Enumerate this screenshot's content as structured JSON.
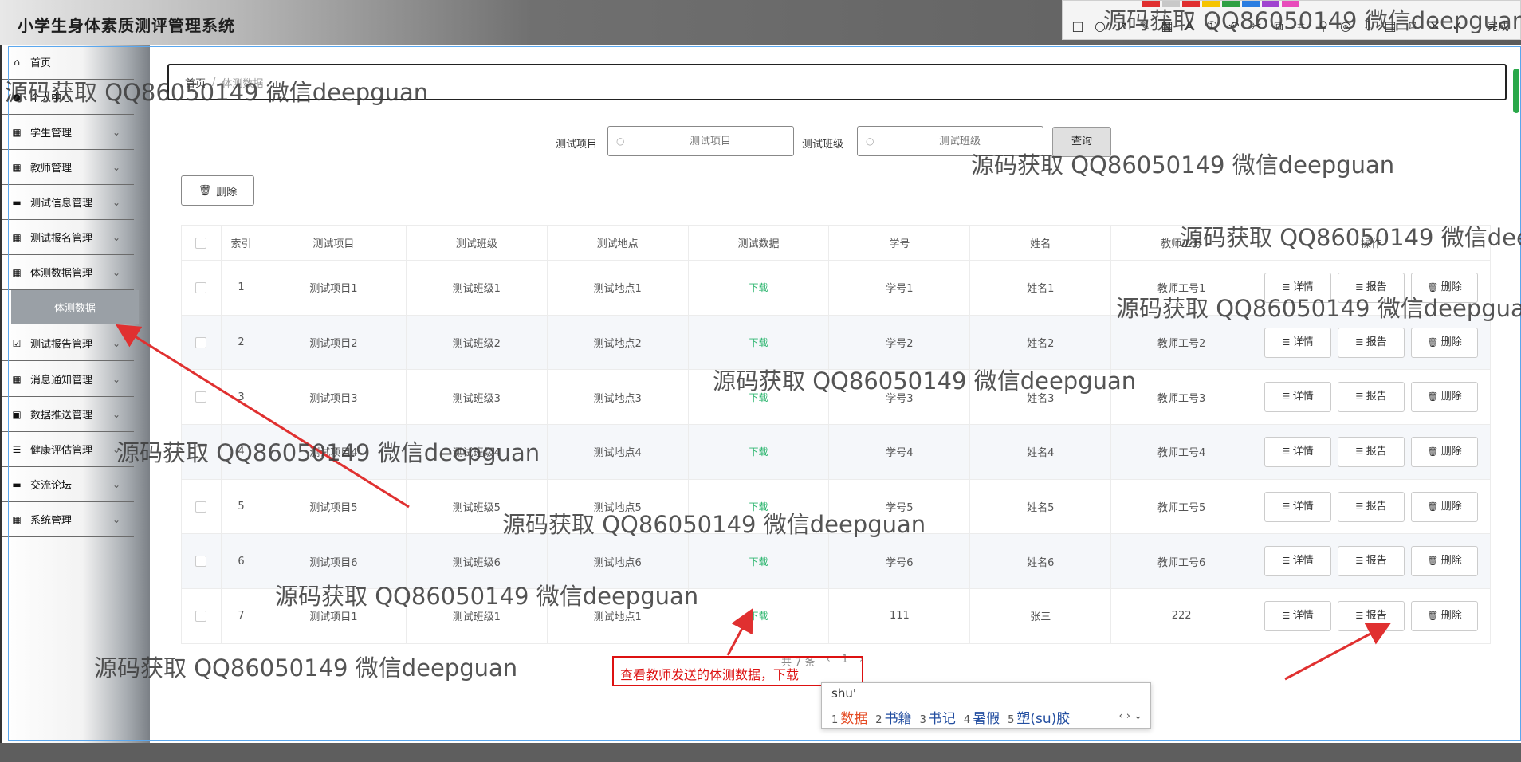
{
  "app": {
    "title": "小学生身体素质测评管理系统"
  },
  "sidebar": {
    "items": [
      {
        "label": "首页",
        "icon": "home-icon",
        "has_children": false
      },
      {
        "label": "个人中心",
        "icon": "user-icon",
        "has_children": false
      },
      {
        "label": "学生管理",
        "icon": "grid-icon",
        "has_children": true
      },
      {
        "label": "教师管理",
        "icon": "grid-icon",
        "has_children": true
      },
      {
        "label": "测试信息管理",
        "icon": "card-icon",
        "has_children": true
      },
      {
        "label": "测试报名管理",
        "icon": "grid-icon",
        "has_children": true
      },
      {
        "label": "体测数据管理",
        "icon": "grid-icon",
        "has_children": true
      },
      {
        "label": "测试报告管理",
        "icon": "check-icon",
        "has_children": true
      },
      {
        "label": "消息通知管理",
        "icon": "grid-icon",
        "has_children": true
      },
      {
        "label": "数据推送管理",
        "icon": "chart-icon",
        "has_children": true
      },
      {
        "label": "健康评估管理",
        "icon": "sliders-icon",
        "has_children": true
      },
      {
        "label": "交流论坛",
        "icon": "chat-icon",
        "has_children": true
      },
      {
        "label": "系统管理",
        "icon": "grid-icon",
        "has_children": true
      }
    ],
    "active_sub": "体测数据"
  },
  "breadcrumb": {
    "home": "首页",
    "current": "体测数据"
  },
  "search": {
    "field1_label": "测试项目",
    "field1_placeholder": "测试项目",
    "field2_label": "测试班级",
    "field2_placeholder": "测试班级",
    "query_label": "查询"
  },
  "toolbar": {
    "delete_label": "删除"
  },
  "table": {
    "headers": [
      "索引",
      "测试项目",
      "测试班级",
      "测试地点",
      "测试数据",
      "学号",
      "姓名",
      "教师工号",
      "操作"
    ],
    "download_label": "下载",
    "actions": {
      "detail": "详情",
      "report": "报告",
      "delete": "删除"
    },
    "rows": [
      {
        "index": "1",
        "project": "测试项目1",
        "class": "测试班级1",
        "location": "测试地点1",
        "student_no": "学号1",
        "name": "姓名1",
        "teacher_no": "教师工号1"
      },
      {
        "index": "2",
        "project": "测试项目2",
        "class": "测试班级2",
        "location": "测试地点2",
        "student_no": "学号2",
        "name": "姓名2",
        "teacher_no": "教师工号2"
      },
      {
        "index": "3",
        "project": "测试项目3",
        "class": "测试班级3",
        "location": "测试地点3",
        "student_no": "学号3",
        "name": "姓名3",
        "teacher_no": "教师工号3"
      },
      {
        "index": "4",
        "project": "测试项目4",
        "class": "测试班级4",
        "location": "测试地点4",
        "student_no": "学号4",
        "name": "姓名4",
        "teacher_no": "教师工号4"
      },
      {
        "index": "5",
        "project": "测试项目5",
        "class": "测试班级5",
        "location": "测试地点5",
        "student_no": "学号5",
        "name": "姓名5",
        "teacher_no": "教师工号5"
      },
      {
        "index": "6",
        "project": "测试项目6",
        "class": "测试班级6",
        "location": "测试地点6",
        "student_no": "学号6",
        "name": "姓名6",
        "teacher_no": "教师工号6"
      },
      {
        "index": "7",
        "project": "测试项目1",
        "class": "测试班级1",
        "location": "测试地点1",
        "student_no": "111",
        "name": "张三",
        "teacher_no": "222"
      }
    ]
  },
  "pager": {
    "total_text": "共 7 条",
    "prev": "‹",
    "page": "1",
    "next": "›"
  },
  "annotation": {
    "text": "查看教师发送的体测数据，下载"
  },
  "ime": {
    "input": "shu'",
    "candidates": [
      {
        "num": "1",
        "text": "数据"
      },
      {
        "num": "2",
        "text": "书籍"
      },
      {
        "num": "3",
        "text": "书记"
      },
      {
        "num": "4",
        "text": "暑假"
      },
      {
        "num": "5",
        "text": "塑(su)胶"
      }
    ]
  },
  "snip_tool": {
    "done_label": "完成"
  },
  "watermark": "源码获取 QQ86050149 微信deepguan",
  "colors": {
    "accent_green": "#2bb56e",
    "annotation_red": "#dd1111",
    "sidebar_gray": "#9aa0a6"
  }
}
